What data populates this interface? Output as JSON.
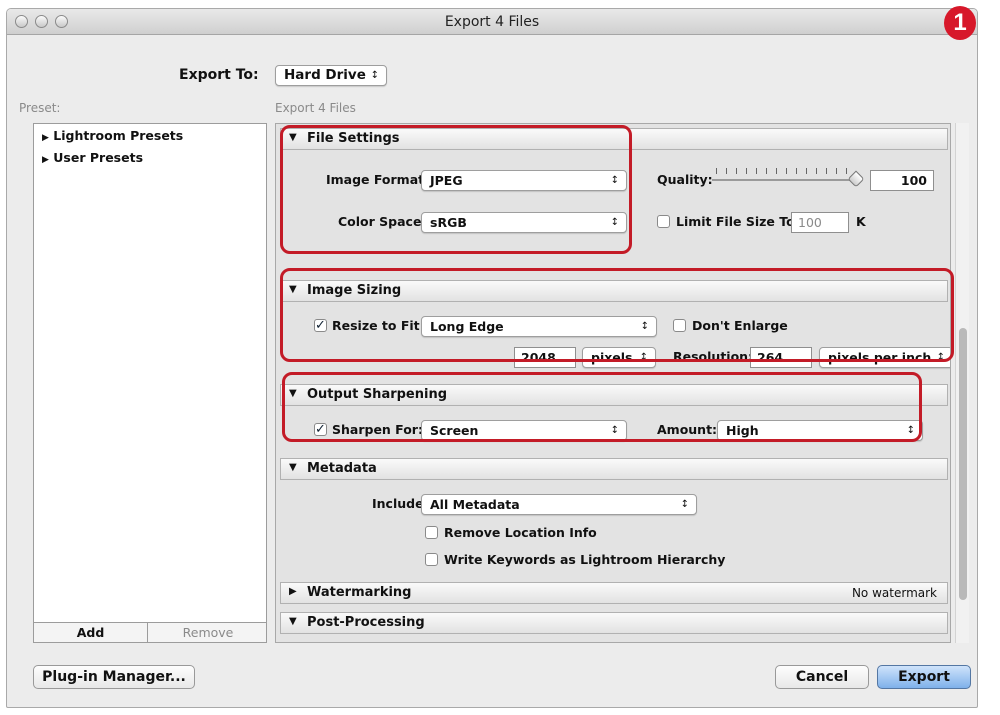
{
  "window": {
    "title": "Export 4 Files"
  },
  "annotation": {
    "badge_number": "1",
    "highlight_color": "#c31b27"
  },
  "export_to": {
    "label": "Export To:",
    "value": "Hard Drive"
  },
  "preset": {
    "header": "Preset:",
    "items": [
      "Lightroom Presets",
      "User Presets"
    ],
    "add_label": "Add",
    "remove_label": "Remove"
  },
  "panel_header": "Export 4 Files",
  "file_settings": {
    "title": "File Settings",
    "image_format_label": "Image Format:",
    "image_format_value": "JPEG",
    "color_space_label": "Color Space:",
    "color_space_value": "sRGB",
    "quality_label": "Quality:",
    "quality_value": "100",
    "limit_size_label": "Limit File Size To:",
    "limit_size_value": "100",
    "limit_size_unit": "K",
    "limit_size_checked": false
  },
  "image_sizing": {
    "title": "Image Sizing",
    "resize_label": "Resize to Fit:",
    "resize_checked": true,
    "resize_value": "Long Edge",
    "dont_enlarge_label": "Don't Enlarge",
    "dont_enlarge_checked": false,
    "dimension_value": "2048",
    "dimension_unit": "pixels",
    "resolution_label": "Resolution:",
    "resolution_value": "264",
    "resolution_unit": "pixels per inch"
  },
  "output_sharpening": {
    "title": "Output Sharpening",
    "sharpen_label": "Sharpen For:",
    "sharpen_checked": true,
    "sharpen_value": "Screen",
    "amount_label": "Amount:",
    "amount_value": "High"
  },
  "metadata": {
    "title": "Metadata",
    "include_label": "Include:",
    "include_value": "All Metadata",
    "remove_location_label": "Remove Location Info",
    "write_keywords_label": "Write Keywords as Lightroom Hierarchy"
  },
  "watermarking": {
    "title": "Watermarking",
    "status": "No watermark"
  },
  "post_processing": {
    "title": "Post-Processing"
  },
  "footer": {
    "plugin_manager_label": "Plug-in Manager...",
    "cancel_label": "Cancel",
    "export_label": "Export"
  }
}
